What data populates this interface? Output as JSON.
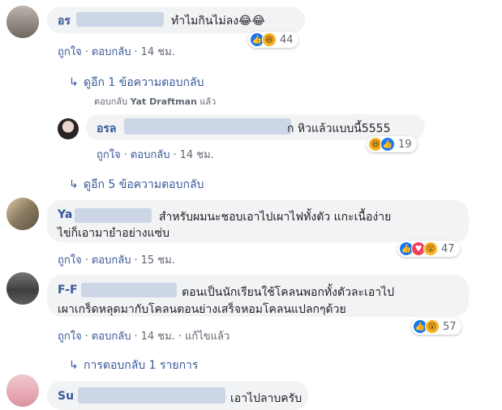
{
  "comments": [
    {
      "name": "อร",
      "text": "ทำไมกินไม่ลง😂😂",
      "reaction_icons": [
        "like-icon",
        "haha-icon"
      ],
      "reaction_count": "44",
      "like_label": "ถูกใจ",
      "reply_label": "ตอบกลับ",
      "time": "14 ชม."
    },
    {
      "name": "อรล",
      "text": "ก หิวแล้วแบบนี้5555",
      "reaction_icons": [
        "haha-icon",
        "like-icon"
      ],
      "reaction_count": "19",
      "like_label": "ถูกใจ",
      "reply_label": "ตอบกลับ",
      "time": "14 ชม."
    },
    {
      "name": "Ya",
      "text_line1": "สำหรับผมนะชอบเอาไปเผาไฟทั้งตัว แกะเนื้อง่าย",
      "text_line2": "ไข่ก็เอามายำอย่างแซ่บ",
      "reaction_icons": [
        "like-icon",
        "love-icon",
        "wow-icon"
      ],
      "reaction_count": "47",
      "like_label": "ถูกใจ",
      "reply_label": "ตอบกลับ",
      "time": "15 ชม."
    },
    {
      "name": "F-F",
      "text_line1": "ตอนเป็นนักเรียนใช้โคลนพอกทั้งตัวละเอาไป",
      "text_line2": "เผาเกร็ดหลุดมากับโคลนตอนย่างเสร็จหอมโคลนแปลกๆด้วย",
      "reaction_icons": [
        "like-icon",
        "wow-icon"
      ],
      "reaction_count": "57",
      "like_label": "ถูกใจ",
      "reply_label": "ตอบกลับ",
      "time": "14 ชม.",
      "edited_label": "แก้ไขแล้ว"
    },
    {
      "name": "Su",
      "text": "เอาไปลาบครับ"
    }
  ],
  "reply_links": {
    "first": "ดูอีก 1 ข้อความตอบกลับ",
    "second": "ดูอีก 5 ข้อความตอบกลับ",
    "third": "การตอบกลับ 1 รายการ"
  },
  "replied_by": {
    "prefix": "ตอบกลับ",
    "name": "Yat Draftman",
    "suffix": "แล้ว"
  },
  "separator": "·"
}
